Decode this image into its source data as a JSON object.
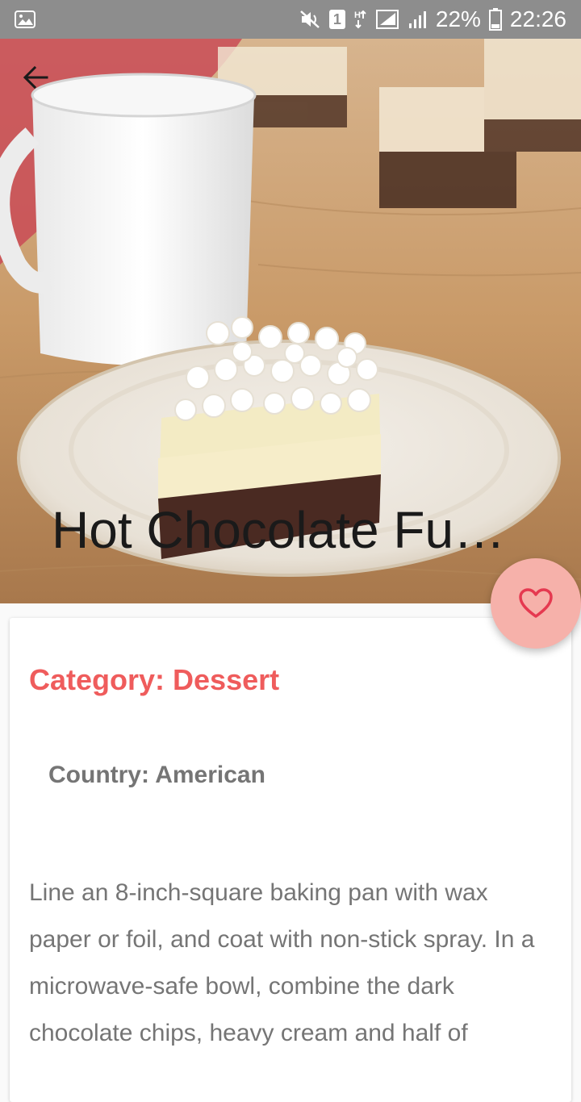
{
  "status_bar": {
    "battery_percent": "22%",
    "time": "22:26",
    "sim_badge": "1",
    "icons": [
      "gallery-icon",
      "mute-icon",
      "sim-icon",
      "data-icon",
      "signal-icon",
      "signal-icon",
      "battery-icon"
    ]
  },
  "hero": {
    "title": "Hot Chocolate Fu…",
    "back_icon": "arrow-left-icon"
  },
  "fab": {
    "icon": "heart-outline-icon",
    "color": "#f6b1aa",
    "icon_color": "#e53950"
  },
  "card": {
    "category": "Category: Dessert",
    "country": "Country: American",
    "instructions": "Line an 8-inch-square baking pan with wax paper or foil, and coat with non-stick spray. In a microwave-safe bowl, combine the dark chocolate chips, heavy cream and half of"
  },
  "colors": {
    "accent": "#ef5c5c",
    "status_bar": "#8d8d8d",
    "secondary_text": "#757575"
  }
}
